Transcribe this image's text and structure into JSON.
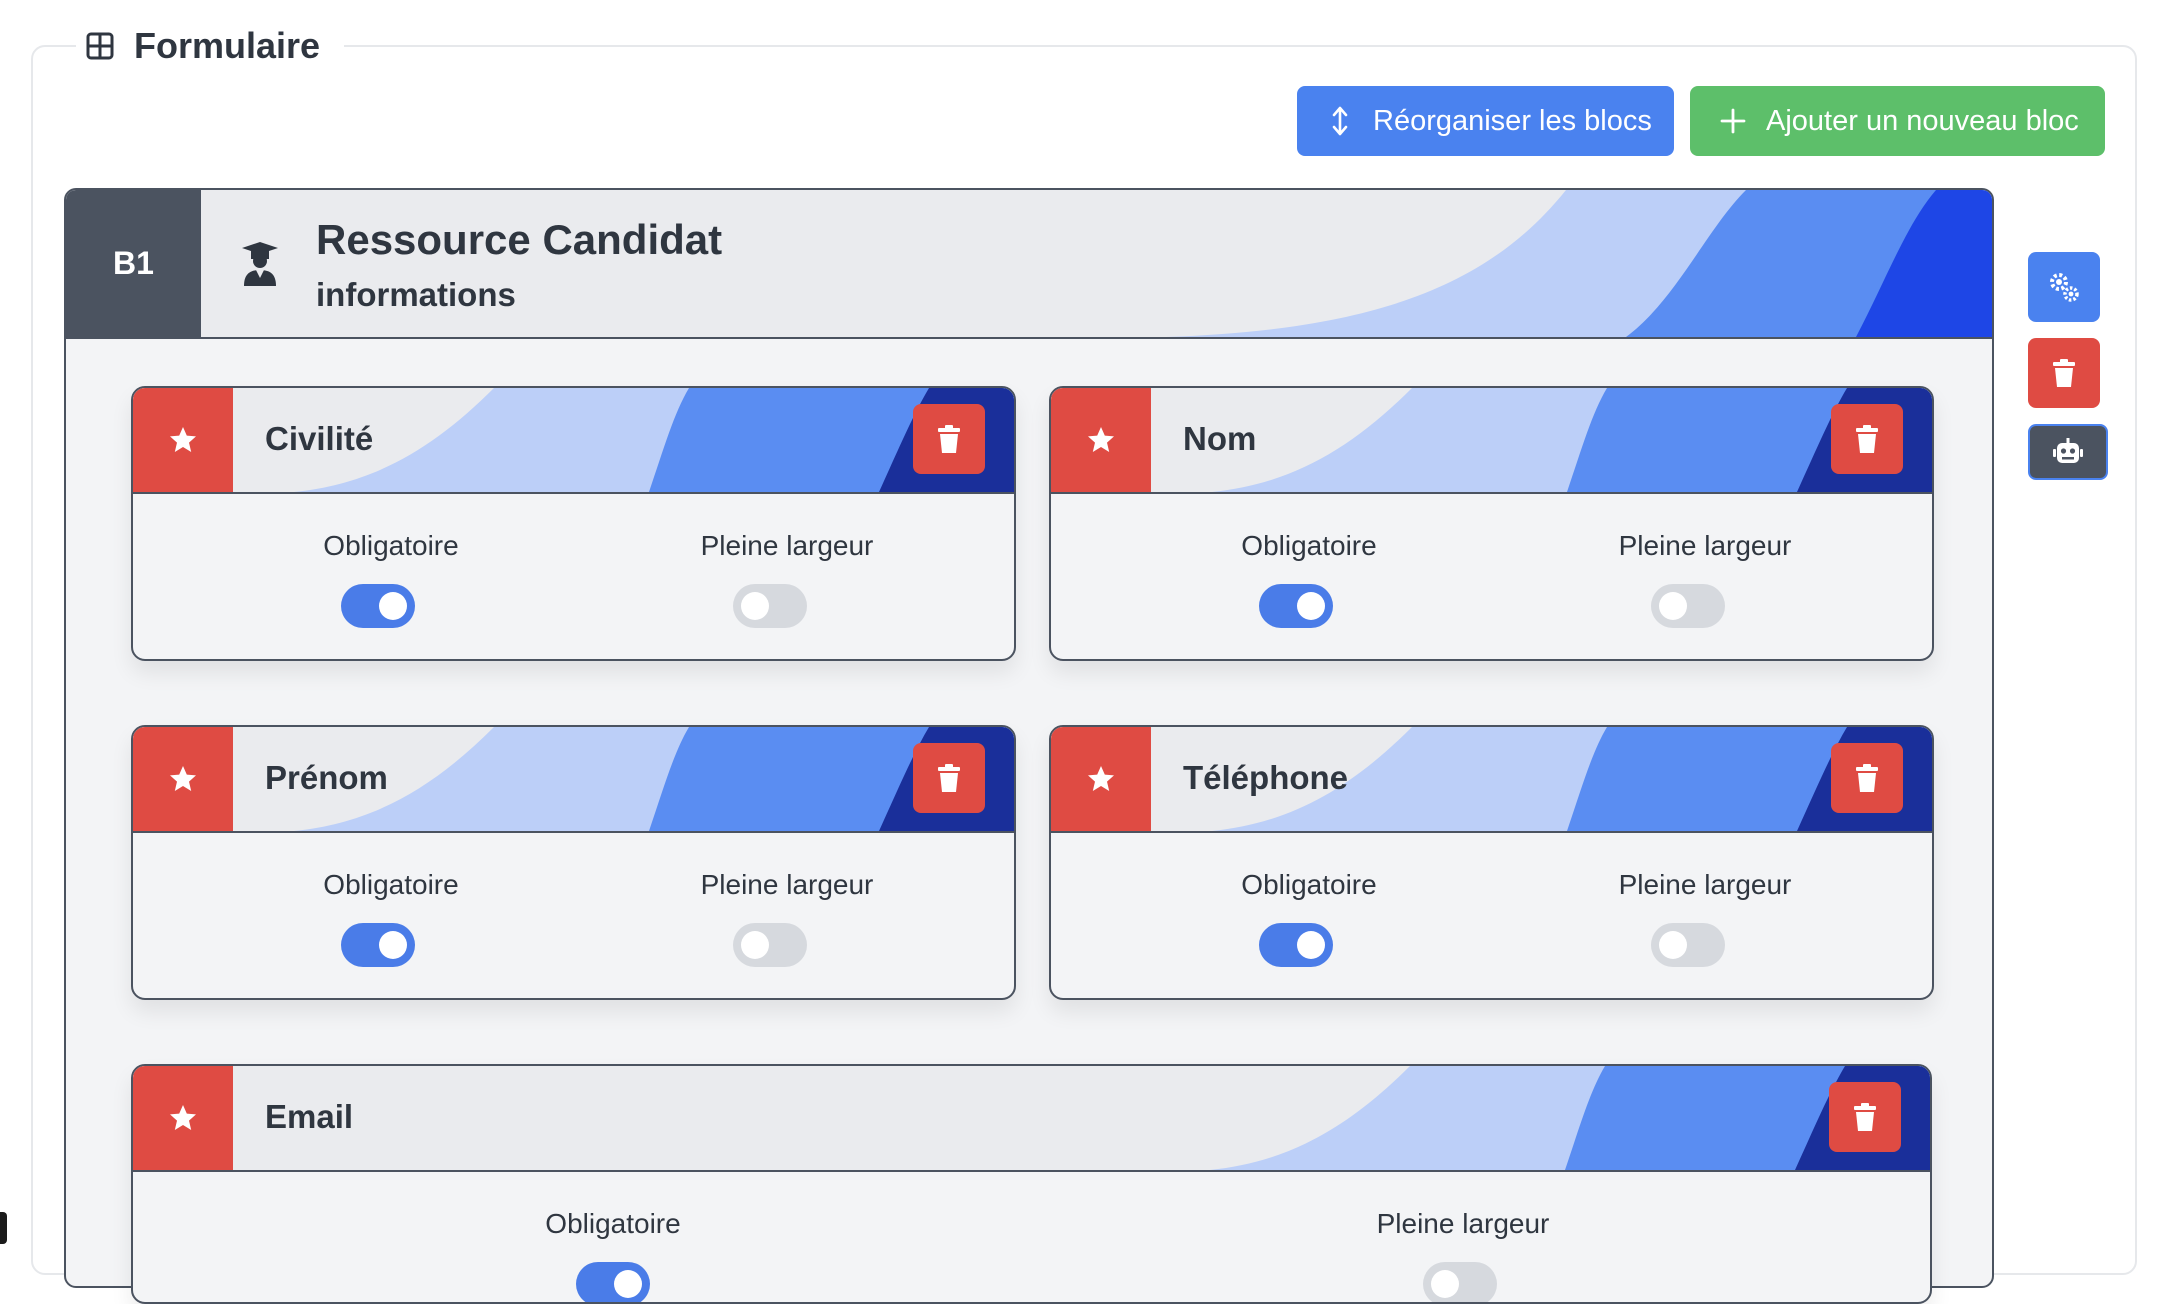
{
  "colors": {
    "primary": "#4a82ef",
    "success": "#5dbf6a",
    "danger": "#df4b43",
    "dark": "#4b5360",
    "wave_light": "#bccff8",
    "wave_mid": "#5a8df2",
    "wave_dark": "#1a2f9a"
  },
  "section": {
    "title": "Formulaire",
    "icon": "grid-icon"
  },
  "toolbar": {
    "reorganize_label": "Réorganiser les blocs",
    "reorganize_icon": "arrows-vertical-icon",
    "add_label": "Ajouter un nouveau bloc",
    "add_icon": "plus-icon"
  },
  "block": {
    "number": "B1",
    "icon": "user-graduate-icon",
    "title": "Ressource Candidat",
    "subtitle": "informations"
  },
  "side_actions": [
    {
      "name": "settings",
      "icon": "gears-icon"
    },
    {
      "name": "delete",
      "icon": "trash-icon"
    },
    {
      "name": "ai",
      "icon": "robot-icon"
    }
  ],
  "fields": [
    {
      "label": "Civilité",
      "required_label": "Obligatoire",
      "full_width_label": "Pleine largeur",
      "required": true,
      "full_width": false
    },
    {
      "label": "Nom",
      "required_label": "Obligatoire",
      "full_width_label": "Pleine largeur",
      "required": true,
      "full_width": false
    },
    {
      "label": "Prénom",
      "required_label": "Obligatoire",
      "full_width_label": "Pleine largeur",
      "required": true,
      "full_width": false
    },
    {
      "label": "Téléphone",
      "required_label": "Obligatoire",
      "full_width_label": "Pleine largeur",
      "required": true,
      "full_width": false
    },
    {
      "label": "Email",
      "required_label": "Obligatoire",
      "full_width_label": "Pleine largeur",
      "required": true,
      "full_width": true
    }
  ]
}
